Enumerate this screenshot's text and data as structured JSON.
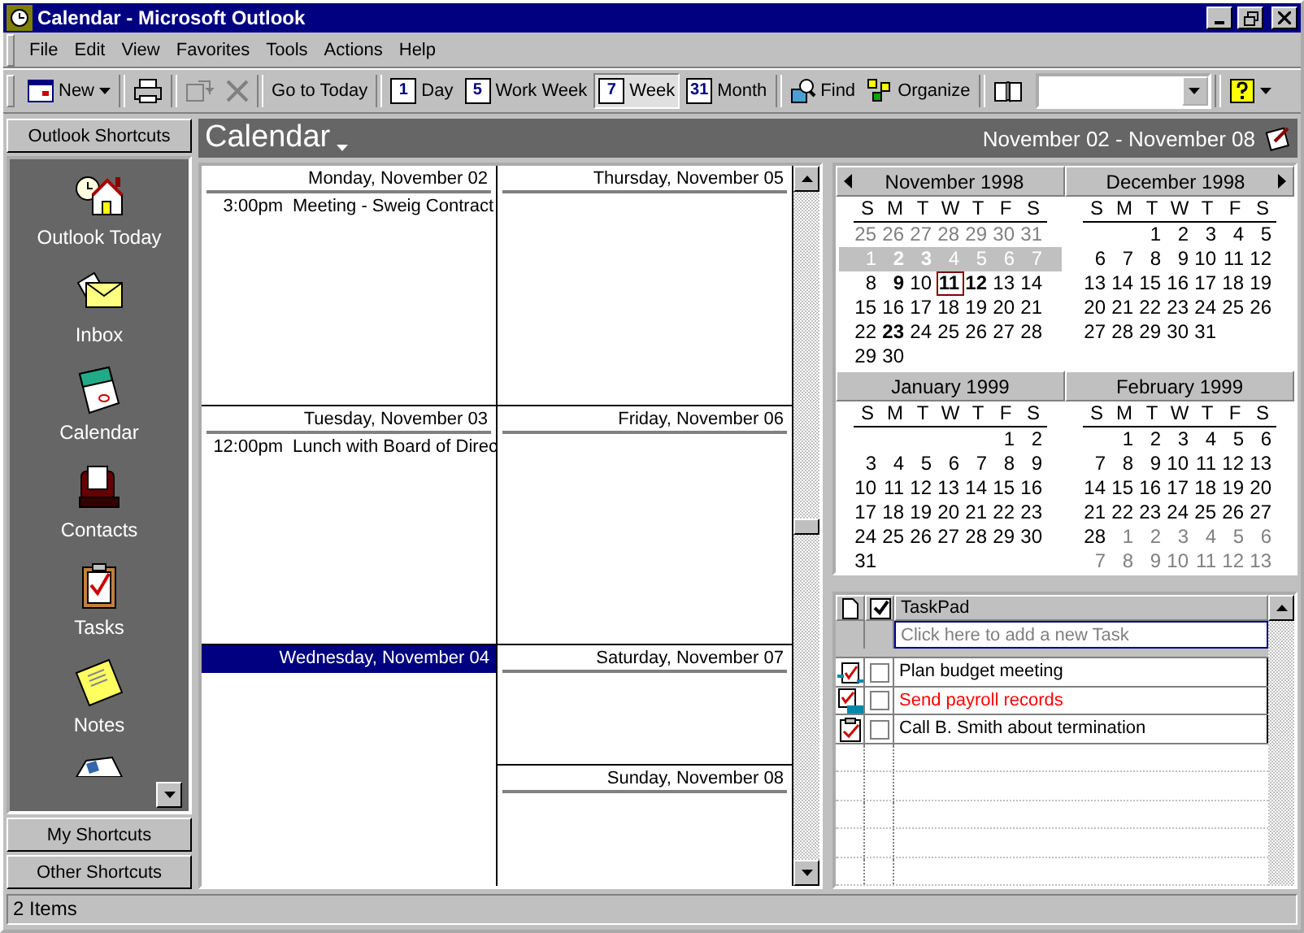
{
  "window": {
    "title": "Calendar - Microsoft Outlook"
  },
  "menu": [
    "File",
    "Edit",
    "View",
    "Favorites",
    "Tools",
    "Actions",
    "Help"
  ],
  "toolbar": {
    "new_label": "New",
    "today_label": "Go to Today",
    "views": [
      {
        "badge": "1",
        "label": "Day",
        "selected": false
      },
      {
        "badge": "5",
        "label": "Work Week",
        "selected": false
      },
      {
        "badge": "7",
        "label": "Week",
        "selected": true
      },
      {
        "badge": "31",
        "label": "Month",
        "selected": false
      }
    ],
    "find_label": "Find",
    "organize_label": "Organize"
  },
  "shortcuts": {
    "header": "Outlook Shortcuts",
    "items": [
      {
        "kind": "today",
        "label": "Outlook Today"
      },
      {
        "kind": "inbox",
        "label": "Inbox"
      },
      {
        "kind": "calendar",
        "label": "Calendar"
      },
      {
        "kind": "contacts",
        "label": "Contacts"
      },
      {
        "kind": "tasks",
        "label": "Tasks"
      },
      {
        "kind": "notes",
        "label": "Notes"
      },
      {
        "kind": "journal"
      }
    ],
    "groups": [
      "My Shortcuts",
      "Other Shortcuts"
    ]
  },
  "calendar": {
    "title": "Calendar",
    "range": "November 02 - November 08",
    "days": [
      {
        "label": "Monday, November 02",
        "selected": false,
        "appointments": [
          {
            "time": "3:00pm",
            "subject": "Meeting - Sweig Contract"
          }
        ]
      },
      {
        "label": "Tuesday, November 03",
        "selected": false,
        "appointments": [
          {
            "time": "12:00pm",
            "subject": "Lunch with Board of Direc"
          }
        ]
      },
      {
        "label": "Wednesday, November 04",
        "selected": true
      },
      {
        "label": "Thursday, November 05",
        "selected": false
      },
      {
        "label": "Friday, November 06",
        "selected": false
      },
      {
        "label": "Saturday, November 07",
        "selected": false
      },
      {
        "label": "Sunday, November 08",
        "selected": false
      }
    ]
  },
  "date_navigator": {
    "months": [
      {
        "title": "November 1998",
        "weekdays": [
          "S",
          "M",
          "T",
          "W",
          "T",
          "F",
          "S"
        ],
        "weeks": [
          {
            "selected": false,
            "days": [
              {
                "n": "25",
                "kind": "dim"
              },
              {
                "n": "26",
                "kind": "dim"
              },
              {
                "n": "27",
                "kind": "dim"
              },
              {
                "n": "28",
                "kind": "dim"
              },
              {
                "n": "29",
                "kind": "dim"
              },
              {
                "n": "30",
                "kind": "dim"
              },
              {
                "n": "31",
                "kind": "dim"
              }
            ]
          },
          {
            "selected": true,
            "days": [
              {
                "n": "1",
                "kind": "plain"
              },
              {
                "n": "2",
                "kind": "bold"
              },
              {
                "n": "3",
                "kind": "bold"
              },
              {
                "n": "4",
                "kind": "plain"
              },
              {
                "n": "5",
                "kind": "plain"
              },
              {
                "n": "6",
                "kind": "plain"
              },
              {
                "n": "7",
                "kind": "plain"
              }
            ]
          },
          {
            "selected": false,
            "days": [
              {
                "n": "8",
                "kind": "plain"
              },
              {
                "n": "9",
                "kind": "bold"
              },
              {
                "n": "10",
                "kind": "plain"
              },
              {
                "n": "11",
                "kind": "today"
              },
              {
                "n": "12",
                "kind": "bold"
              },
              {
                "n": "13",
                "kind": "plain"
              },
              {
                "n": "14",
                "kind": "plain"
              }
            ]
          },
          {
            "selected": false,
            "days": [
              {
                "n": "15",
                "kind": "plain"
              },
              {
                "n": "16",
                "kind": "plain"
              },
              {
                "n": "17",
                "kind": "plain"
              },
              {
                "n": "18",
                "kind": "plain"
              },
              {
                "n": "19",
                "kind": "plain"
              },
              {
                "n": "20",
                "kind": "plain"
              },
              {
                "n": "21",
                "kind": "plain"
              }
            ]
          },
          {
            "selected": false,
            "days": [
              {
                "n": "22",
                "kind": "plain"
              },
              {
                "n": "23",
                "kind": "bold"
              },
              {
                "n": "24",
                "kind": "plain"
              },
              {
                "n": "25",
                "kind": "plain"
              },
              {
                "n": "26",
                "kind": "plain"
              },
              {
                "n": "27",
                "kind": "plain"
              },
              {
                "n": "28",
                "kind": "plain"
              }
            ]
          },
          {
            "selected": false,
            "days": [
              {
                "n": "29",
                "kind": "plain"
              },
              {
                "n": "30",
                "kind": "plain"
              }
            ]
          }
        ]
      },
      {
        "title": "December 1998",
        "weekdays": [
          "S",
          "M",
          "T",
          "W",
          "T",
          "F",
          "S"
        ],
        "weeks": [
          {
            "selected": false,
            "days": [
              {
                "n": "1",
                "kind": "plain"
              },
              {
                "n": "2",
                "kind": "plain"
              },
              {
                "n": "3",
                "kind": "plain"
              },
              {
                "n": "4",
                "kind": "plain"
              },
              {
                "n": "5",
                "kind": "plain"
              }
            ]
          },
          {
            "selected": false,
            "days": [
              {
                "n": "6",
                "kind": "plain"
              },
              {
                "n": "7",
                "kind": "plain"
              },
              {
                "n": "8",
                "kind": "plain"
              },
              {
                "n": "9",
                "kind": "plain"
              },
              {
                "n": "10",
                "kind": "plain"
              },
              {
                "n": "11",
                "kind": "plain"
              },
              {
                "n": "12",
                "kind": "plain"
              }
            ]
          },
          {
            "selected": false,
            "days": [
              {
                "n": "13",
                "kind": "plain"
              },
              {
                "n": "14",
                "kind": "plain"
              },
              {
                "n": "15",
                "kind": "plain"
              },
              {
                "n": "16",
                "kind": "plain"
              },
              {
                "n": "17",
                "kind": "plain"
              },
              {
                "n": "18",
                "kind": "plain"
              },
              {
                "n": "19",
                "kind": "plain"
              }
            ]
          },
          {
            "selected": false,
            "days": [
              {
                "n": "20",
                "kind": "plain"
              },
              {
                "n": "21",
                "kind": "plain"
              },
              {
                "n": "22",
                "kind": "plain"
              },
              {
                "n": "23",
                "kind": "plain"
              },
              {
                "n": "24",
                "kind": "plain"
              },
              {
                "n": "25",
                "kind": "plain"
              },
              {
                "n": "26",
                "kind": "plain"
              }
            ]
          },
          {
            "selected": false,
            "days": [
              {
                "n": "27",
                "kind": "plain"
              },
              {
                "n": "28",
                "kind": "plain"
              },
              {
                "n": "29",
                "kind": "plain"
              },
              {
                "n": "30",
                "kind": "plain"
              },
              {
                "n": "31",
                "kind": "plain"
              }
            ]
          }
        ]
      },
      {
        "title": "January 1999",
        "weekdays": [
          "S",
          "M",
          "T",
          "W",
          "T",
          "F",
          "S"
        ],
        "weeks": [
          {
            "selected": false,
            "days": [
              {
                "n": "1",
                "kind": "plain"
              },
              {
                "n": "2",
                "kind": "plain"
              }
            ]
          },
          {
            "selected": false,
            "days": [
              {
                "n": "3",
                "kind": "plain"
              },
              {
                "n": "4",
                "kind": "plain"
              },
              {
                "n": "5",
                "kind": "plain"
              },
              {
                "n": "6",
                "kind": "plain"
              },
              {
                "n": "7",
                "kind": "plain"
              },
              {
                "n": "8",
                "kind": "plain"
              },
              {
                "n": "9",
                "kind": "plain"
              }
            ]
          },
          {
            "selected": false,
            "days": [
              {
                "n": "10",
                "kind": "plain"
              },
              {
                "n": "11",
                "kind": "plain"
              },
              {
                "n": "12",
                "kind": "plain"
              },
              {
                "n": "13",
                "kind": "plain"
              },
              {
                "n": "14",
                "kind": "plain"
              },
              {
                "n": "15",
                "kind": "plain"
              },
              {
                "n": "16",
                "kind": "plain"
              }
            ]
          },
          {
            "selected": false,
            "days": [
              {
                "n": "17",
                "kind": "plain"
              },
              {
                "n": "18",
                "kind": "plain"
              },
              {
                "n": "19",
                "kind": "plain"
              },
              {
                "n": "20",
                "kind": "plain"
              },
              {
                "n": "21",
                "kind": "plain"
              },
              {
                "n": "22",
                "kind": "plain"
              },
              {
                "n": "23",
                "kind": "plain"
              }
            ]
          },
          {
            "selected": false,
            "days": [
              {
                "n": "24",
                "kind": "plain"
              },
              {
                "n": "25",
                "kind": "plain"
              },
              {
                "n": "26",
                "kind": "plain"
              },
              {
                "n": "27",
                "kind": "plain"
              },
              {
                "n": "28",
                "kind": "plain"
              },
              {
                "n": "29",
                "kind": "plain"
              },
              {
                "n": "30",
                "kind": "plain"
              }
            ]
          },
          {
            "selected": false,
            "days": [
              {
                "n": "31",
                "kind": "plain"
              }
            ]
          }
        ]
      },
      {
        "title": "February 1999",
        "weekdays": [
          "S",
          "M",
          "T",
          "W",
          "T",
          "F",
          "S"
        ],
        "weeks": [
          {
            "selected": false,
            "days": [
              {
                "n": "1",
                "kind": "plain"
              },
              {
                "n": "2",
                "kind": "plain"
              },
              {
                "n": "3",
                "kind": "plain"
              },
              {
                "n": "4",
                "kind": "plain"
              },
              {
                "n": "5",
                "kind": "plain"
              },
              {
                "n": "6",
                "kind": "plain"
              }
            ]
          },
          {
            "selected": false,
            "days": [
              {
                "n": "7",
                "kind": "plain"
              },
              {
                "n": "8",
                "kind": "plain"
              },
              {
                "n": "9",
                "kind": "plain"
              },
              {
                "n": "10",
                "kind": "plain"
              },
              {
                "n": "11",
                "kind": "plain"
              },
              {
                "n": "12",
                "kind": "plain"
              },
              {
                "n": "13",
                "kind": "plain"
              }
            ]
          },
          {
            "selected": false,
            "days": [
              {
                "n": "14",
                "kind": "plain"
              },
              {
                "n": "15",
                "kind": "plain"
              },
              {
                "n": "16",
                "kind": "plain"
              },
              {
                "n": "17",
                "kind": "plain"
              },
              {
                "n": "18",
                "kind": "plain"
              },
              {
                "n": "19",
                "kind": "plain"
              },
              {
                "n": "20",
                "kind": "plain"
              }
            ]
          },
          {
            "selected": false,
            "days": [
              {
                "n": "21",
                "kind": "plain"
              },
              {
                "n": "22",
                "kind": "plain"
              },
              {
                "n": "23",
                "kind": "plain"
              },
              {
                "n": "24",
                "kind": "plain"
              },
              {
                "n": "25",
                "kind": "plain"
              },
              {
                "n": "26",
                "kind": "plain"
              },
              {
                "n": "27",
                "kind": "plain"
              }
            ]
          },
          {
            "selected": false,
            "days": [
              {
                "n": "28",
                "kind": "plain"
              },
              {
                "n": "1",
                "kind": "dim"
              },
              {
                "n": "2",
                "kind": "dim"
              },
              {
                "n": "3",
                "kind": "dim"
              },
              {
                "n": "4",
                "kind": "dim"
              },
              {
                "n": "5",
                "kind": "dim"
              },
              {
                "n": "6",
                "kind": "dim"
              }
            ]
          },
          {
            "selected": false,
            "days": [
              {
                "n": "7",
                "kind": "dim"
              },
              {
                "n": "8",
                "kind": "dim"
              },
              {
                "n": "9",
                "kind": "dim"
              },
              {
                "n": "10",
                "kind": "dim"
              },
              {
                "n": "11",
                "kind": "dim"
              },
              {
                "n": "12",
                "kind": "dim"
              },
              {
                "n": "13",
                "kind": "dim"
              }
            ]
          }
        ]
      }
    ]
  },
  "taskpad": {
    "title": "TaskPad",
    "placeholder": "Click here to add a new Task",
    "tasks": [
      {
        "kind": "request",
        "done": false,
        "overdue": false,
        "subject": "Plan budget meeting"
      },
      {
        "kind": "assigned",
        "done": false,
        "overdue": true,
        "subject": "Send payroll records"
      },
      {
        "kind": "task",
        "done": false,
        "overdue": false,
        "subject": "Call B. Smith about termination"
      }
    ]
  },
  "status_bar": "2 Items"
}
